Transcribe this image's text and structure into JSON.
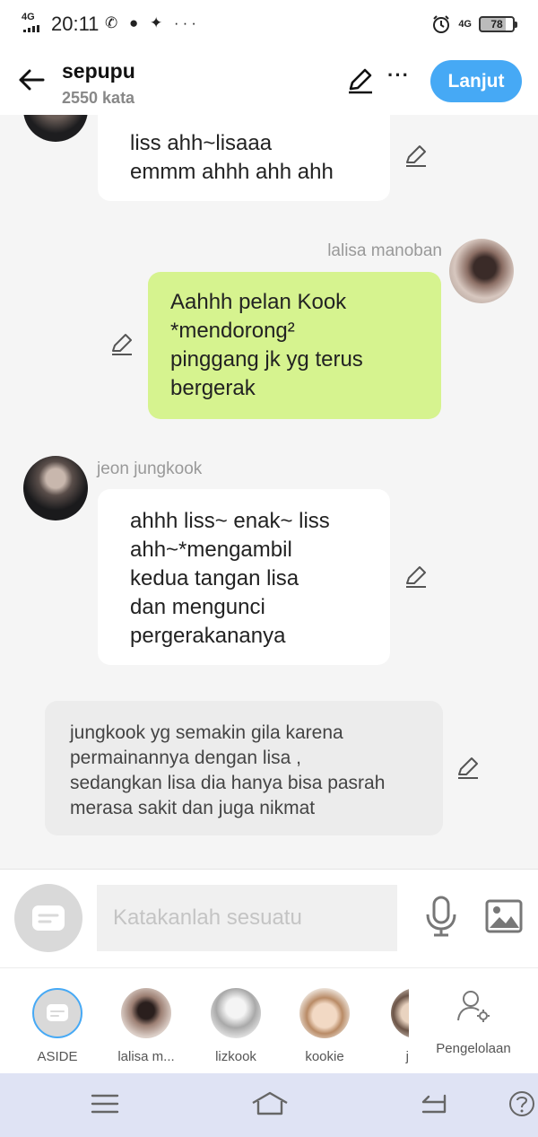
{
  "status_bar": {
    "network": "4G",
    "time": "20:11",
    "apps": "✆ ● ✦ ···",
    "network_right": "4G",
    "battery": "78"
  },
  "header": {
    "title": "sepupu",
    "subtitle": "2550 kata",
    "next_label": "Lanjut"
  },
  "messages": [
    {
      "id": "m1",
      "text": "liss ahh~lisaaa\nemmm ahhh ahh ahh"
    },
    {
      "id": "m2",
      "sender": "lalisa manoban",
      "text": "Aahhh pelan Kook\n*mendorong²\npinggang jk yg terus\nbergerak"
    },
    {
      "id": "m3",
      "sender": "jeon jungkook",
      "text": "ahhh liss~ enak~ liss\nahh~*mengambil\nkedua tangan lisa\ndan mengunci\npergerakananya"
    },
    {
      "id": "m4",
      "text": "jungkook yg semakin gila karena\npermainannya dengan lisa ,\nsedangkan lisa dia hanya bisa pasrah\nmerasa sakit dan juga nikmat"
    }
  ],
  "input": {
    "placeholder": "Katakanlah sesuatu"
  },
  "characters": [
    {
      "name": "ASIDE"
    },
    {
      "name": "lalisa m..."
    },
    {
      "name": "lizkook"
    },
    {
      "name": "kookie"
    },
    {
      "name": "j"
    }
  ],
  "management_label": "Pengelolaan",
  "colors": {
    "accent": "#46a9f5",
    "user_bubble": "#d6f38f",
    "bubble": "#ffffff",
    "background": "#f5f5f5",
    "nav": "#dfe3f4"
  }
}
